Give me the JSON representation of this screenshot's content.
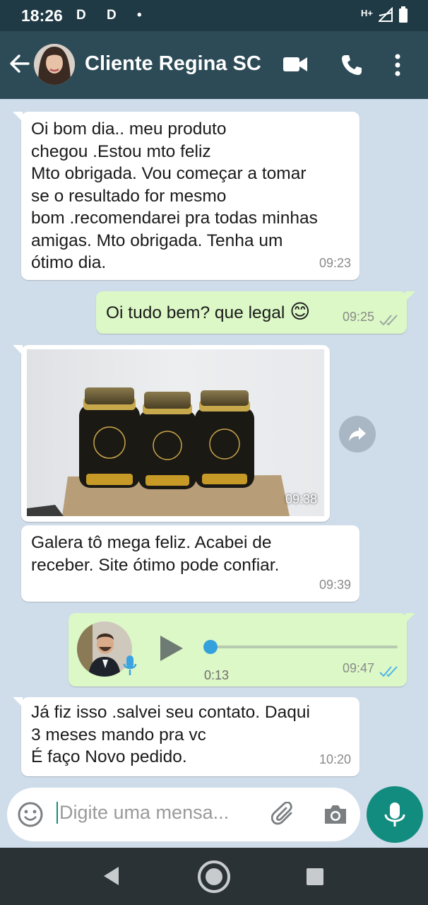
{
  "status_bar": {
    "time": "18:26",
    "left_icons": "D D •",
    "network": "H+"
  },
  "header": {
    "contact_name": "Cliente Regina SC"
  },
  "messages": [
    {
      "direction": "in",
      "lines": [
        "Oi bom dia.. meu produto",
        "chegou .Estou mto feliz",
        "Mto obrigada. Vou começar a tomar",
        "se o resultado for mesmo",
        "bom .recomendarei pra todas minhas",
        "amigas. Mto obrigada. Tenha um",
        "ótimo dia."
      ],
      "time": "09:23"
    },
    {
      "direction": "out",
      "text": "Oi tudo bem? que legal",
      "emoji": "😊",
      "time": "09:25",
      "status": "delivered"
    },
    {
      "direction": "in",
      "type": "image",
      "time": "09:38"
    },
    {
      "direction": "in",
      "lines": [
        "Galera tô  mega feliz. Acabei de",
        "receber. Site ótimo pode confiar."
      ],
      "time": "09:39"
    },
    {
      "direction": "out",
      "type": "voice",
      "duration": "0:13",
      "progress": 0.0,
      "time": "09:47",
      "status": "read"
    },
    {
      "direction": "in",
      "lines": [
        "Já fiz isso .salvei seu contato. Daqui",
        "3 meses mando pra vc",
        "É faço Novo pedido."
      ],
      "time": "10:20"
    }
  ],
  "composer": {
    "placeholder": "Digite uma mensa..."
  },
  "colors": {
    "header": "#2c4b57",
    "status_bar": "#1f3a45",
    "outgoing_bubble": "#dcf8c6",
    "incoming_bubble": "#ffffff",
    "background": "#cfdce9",
    "accent": "#128c7e",
    "read_ticks": "#4fb4e8"
  }
}
